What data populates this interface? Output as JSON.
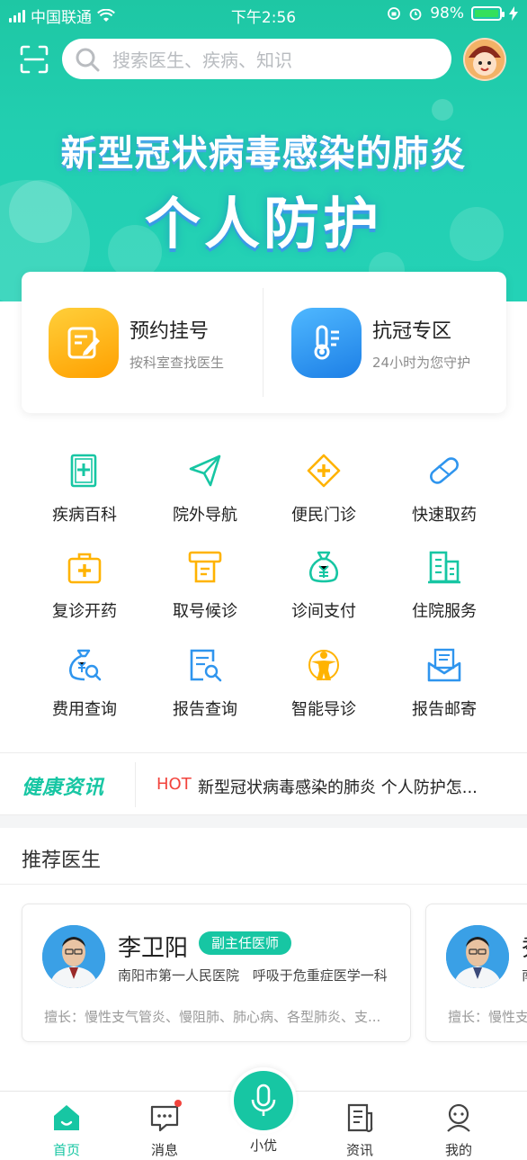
{
  "status_bar": {
    "carrier": "中国联通",
    "time": "下午2:56",
    "battery": "98%"
  },
  "search": {
    "placeholder": "搜索医生、疾病、知识"
  },
  "banner": {
    "line1": "新型冠状病毒感染的肺炎",
    "line2": "个人防护"
  },
  "main_entries": [
    {
      "title": "预约挂号",
      "subtitle": "按科室查找医生",
      "icon": "edit-note-icon",
      "color": "#ffb300"
    },
    {
      "title": "抗冠专区",
      "subtitle": "24小时为您守护",
      "icon": "thermometer-icon",
      "color": "#2f95ee"
    }
  ],
  "services": [
    {
      "label": "疾病百科",
      "icon": "medical-book-icon"
    },
    {
      "label": "院外导航",
      "icon": "paper-plane-icon"
    },
    {
      "label": "便民门诊",
      "icon": "clinic-cross-icon"
    },
    {
      "label": "快速取药",
      "icon": "pill-icon"
    },
    {
      "label": "复诊开药",
      "icon": "medical-kit-icon"
    },
    {
      "label": "取号候诊",
      "icon": "ticket-machine-icon"
    },
    {
      "label": "诊间支付",
      "icon": "money-bag-icon"
    },
    {
      "label": "住院服务",
      "icon": "hospital-building-icon"
    },
    {
      "label": "费用查询",
      "icon": "cost-search-icon"
    },
    {
      "label": "报告查询",
      "icon": "report-search-icon"
    },
    {
      "label": "智能导诊",
      "icon": "person-guide-icon"
    },
    {
      "label": "报告邮寄",
      "icon": "mail-report-icon"
    }
  ],
  "news": {
    "logo": "健康资讯",
    "tag": "HOT",
    "headline": "新型冠状病毒感染的肺炎 个人防护怎..."
  },
  "recommend": {
    "title": "推荐医生",
    "doctors": [
      {
        "name": "李卫阳",
        "title": "副主任医师",
        "hospital": "南阳市第一人民医院",
        "department": "呼吸于危重症医学一科",
        "specialty": "擅长：慢性支气管炎、慢阻肺、肺心病、各型肺炎、支..."
      },
      {
        "name": "秀",
        "title": "",
        "hospital": "南",
        "department": "",
        "specialty": "擅长：慢性支"
      }
    ]
  },
  "tabbar": [
    {
      "label": "首页",
      "icon": "home-icon",
      "active": true
    },
    {
      "label": "消息",
      "icon": "message-icon",
      "active": false
    },
    {
      "label": "小优",
      "icon": "microphone-icon",
      "active": false
    },
    {
      "label": "资讯",
      "icon": "news-icon",
      "active": false
    },
    {
      "label": "我的",
      "icon": "profile-icon",
      "active": false
    }
  ],
  "colors": {
    "primary": "#17c6a3",
    "hot": "#f2433c",
    "orange": "#ffb300",
    "blue": "#2f95ee"
  }
}
